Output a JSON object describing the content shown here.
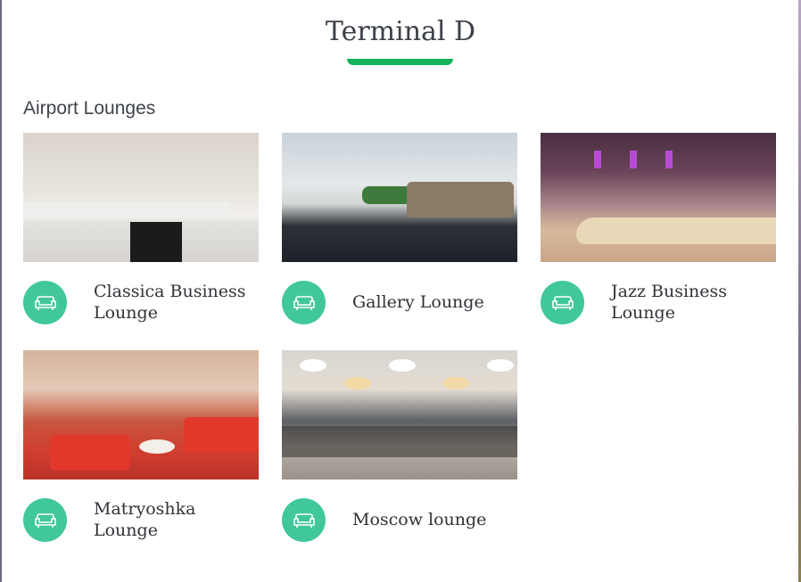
{
  "header": {
    "title": "Terminal D"
  },
  "section": {
    "title": "Airport Lounges"
  },
  "lounges": [
    {
      "name": "Classica Business Lounge",
      "icon": "sofa-icon"
    },
    {
      "name": "Gallery Lounge",
      "icon": "sofa-icon"
    },
    {
      "name": "Jazz Business Lounge",
      "icon": "sofa-icon"
    },
    {
      "name": "Matryoshka Lounge",
      "icon": "sofa-icon"
    },
    {
      "name": "Moscow lounge",
      "icon": "sofa-icon"
    }
  ],
  "colors": {
    "accent": "#12b15a",
    "icon_bg": "#41c79c"
  }
}
